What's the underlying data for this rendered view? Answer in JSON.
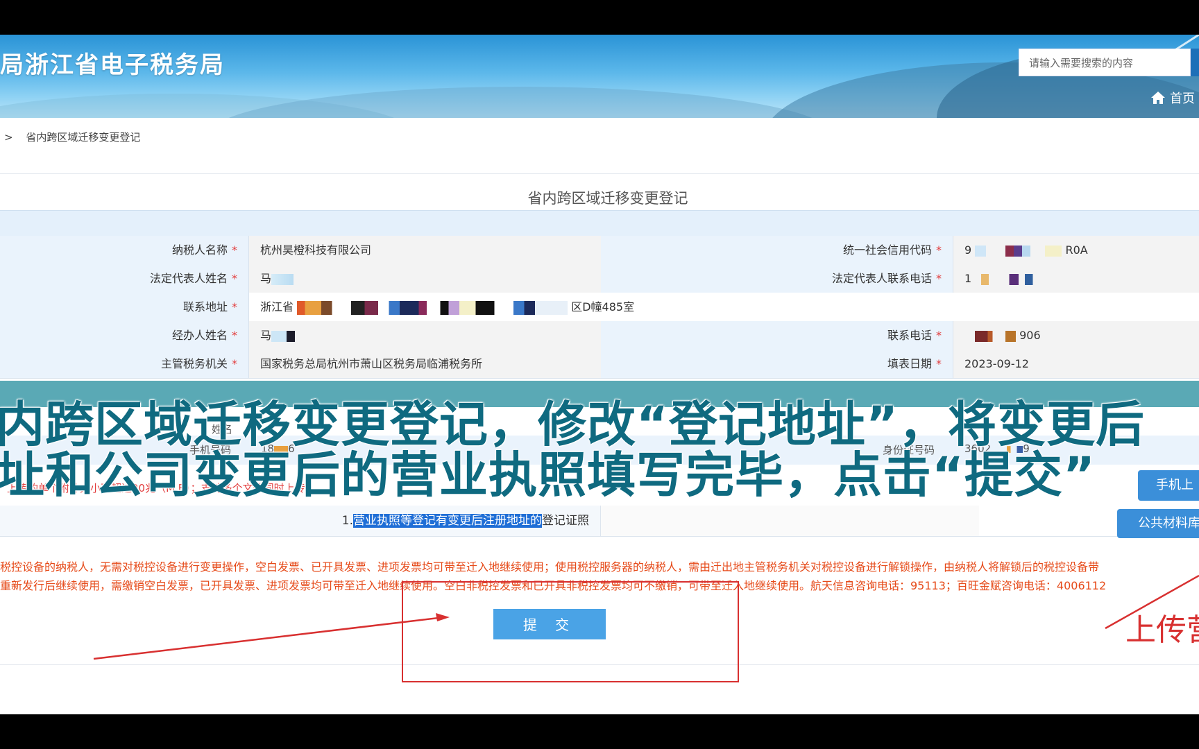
{
  "header": {
    "site_title": "局浙江省电子税务局",
    "search_placeholder": "请输入需要搜索的内容",
    "home_label": "首页"
  },
  "breadcrumb": {
    "separator": ">",
    "current": "省内跨区域迁移变更登记"
  },
  "form": {
    "title": "省内跨区域迁移变更登记",
    "required_mark": "*",
    "rows": [
      {
        "l1": "纳税人名称",
        "v1": "杭州昊橙科技有限公司",
        "l2": "统一社会信用代码",
        "v2": "9",
        "v2b": "R0A"
      },
      {
        "l1": "法定代表人姓名",
        "v1": "马",
        "l2": "法定代表人联系电话",
        "v2": "1"
      },
      {
        "l1": "联系地址",
        "v1": "浙江省",
        "v1b": "区D幢485室"
      },
      {
        "l1": "经办人姓名",
        "v1": "马",
        "l2": "联系电话",
        "v2": "906"
      },
      {
        "l1": "主管税务机关",
        "v1": "国家税务总局杭州市萧山区税务局临浦税务所",
        "l2": "填表日期",
        "v2": "2023-09-12"
      }
    ],
    "lower": {
      "name_label": "姓名",
      "mobile_label": "手机号码",
      "mobile_value": "18",
      "mobile_value_tail": "6",
      "id_label": "身份证号码",
      "id_value": "3602",
      "id_value_tail": "9"
    }
  },
  "attachments": {
    "note": "上传的单个附件大小不超过20兆（M B）；支持多个文件同时上传",
    "item_prefix": "1.",
    "item_highlight": "营业执照等登记有变更后注册地址的",
    "item_suffix": "登记证照",
    "phone_upload_button": "手机上",
    "public_material_button": "公共材料库"
  },
  "notices": {
    "line1": "税控设备的纳税人，无需对税控设备进行变更操作，空白发票、已开具发票、进项发票均可带至迁入地继续使用；使用税控服务器的纳税人，需由迁出地主管税务机关对税控设备进行解锁操作，由纳税人将解锁后的税控设备带",
    "line2": "重新发行后继续使用，需缴销空白发票，已开具发票、进项发票均可带至迁入地继续使用。空白非税控发票和已开具非税控发票均可不缴销，可带至迁入地继续使用。航天信息咨询电话：95113；百旺金赋咨询电话：4006112"
  },
  "submit_label": "提 交",
  "caption": {
    "line1": "内跨区域迁移变更登记，修改“登记地址”，将变更后",
    "line2": "址和公司变更后的营业执照填写完毕，点击“提交”"
  },
  "annotation": {
    "upload_text": "上传营"
  },
  "colors": {
    "accent_blue": "#3b8fd9",
    "caption_teal": "#0f6a80",
    "annotation_red": "#d83030"
  }
}
